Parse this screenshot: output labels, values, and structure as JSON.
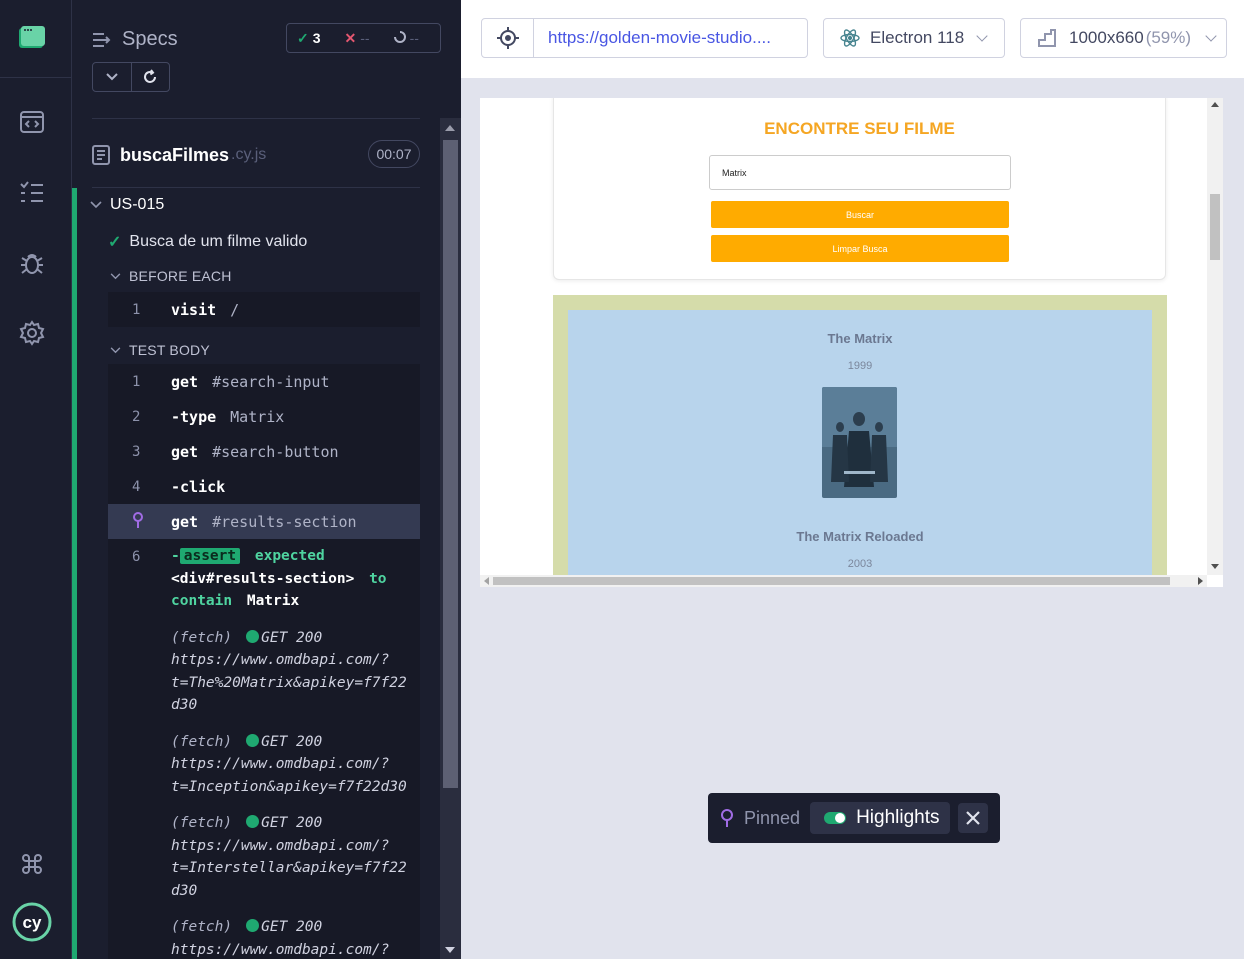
{
  "reporter": {
    "header": "Specs",
    "stats": {
      "passed": "3",
      "failed": "--",
      "pending": "--"
    },
    "file": {
      "name": "buscaFilmes",
      "ext": ".cy.js",
      "duration": "00:07"
    },
    "suite": "US-015",
    "test": "Busca de um filme valido",
    "before_each": {
      "label": "BEFORE EACH",
      "commands": [
        {
          "num": "1",
          "name": "visit",
          "arg": "/"
        }
      ]
    },
    "test_body": {
      "label": "TEST BODY",
      "commands": [
        {
          "num": "1",
          "name": "get",
          "arg": "#search-input"
        },
        {
          "num": "2",
          "name": "-type",
          "arg": "Matrix"
        },
        {
          "num": "3",
          "name": "get",
          "arg": "#search-button"
        },
        {
          "num": "4",
          "name": "-click",
          "arg": ""
        },
        {
          "num": "",
          "name": "get",
          "arg": "#results-section"
        }
      ],
      "assert": {
        "num": "6",
        "dash": "-",
        "badge": "assert",
        "expected": "expected",
        "subject": "<div#results-section>",
        "to": "to",
        "contain": "contain",
        "value": "Matrix"
      },
      "fetches": [
        {
          "label": "(fetch)",
          "status": "GET 200",
          "lines": [
            "https://www.omdbapi.com/?",
            "t=The%20Matrix&apikey=f7f22",
            "d30"
          ]
        },
        {
          "label": "(fetch)",
          "status": "GET 200",
          "lines": [
            "https://www.omdbapi.com/?",
            "t=Inception&apikey=f7f22d30"
          ]
        },
        {
          "label": "(fetch)",
          "status": "GET 200",
          "lines": [
            "https://www.omdbapi.com/?",
            "t=Interstellar&apikey=f7f22",
            "d30"
          ]
        },
        {
          "label": "(fetch)",
          "status": "GET 200",
          "lines": [
            "https://www.omdbapi.com/?"
          ]
        }
      ]
    }
  },
  "aut": {
    "url": "https://golden-movie-studio....",
    "browser": "Electron 118",
    "viewport": "1000x660",
    "scale": "(59%)",
    "page": {
      "title": "ENCONTRE SEU FILME",
      "search_value": "Matrix",
      "search_button": "Buscar",
      "clear_button": "Limpar Busca",
      "movies": [
        {
          "title": "The Matrix",
          "year": "1999"
        },
        {
          "title": "The Matrix Reloaded",
          "year": "2003"
        }
      ]
    },
    "pin_bar": {
      "pinned": "Pinned",
      "highlights": "Highlights",
      "highlights_on": true
    }
  },
  "colors": {
    "accent_green": "#1fa971",
    "brand_orange": "#ffab00",
    "title_orange": "#f5a623",
    "pin_purple": "#a06ce4"
  },
  "icons": {
    "nav": [
      "cypress-app-icon",
      "runs-icon",
      "specs-list-icon",
      "debug-bug-icon",
      "settings-gear-icon",
      "keyboard-shortcuts-icon",
      "cypress-logo-icon"
    ]
  }
}
